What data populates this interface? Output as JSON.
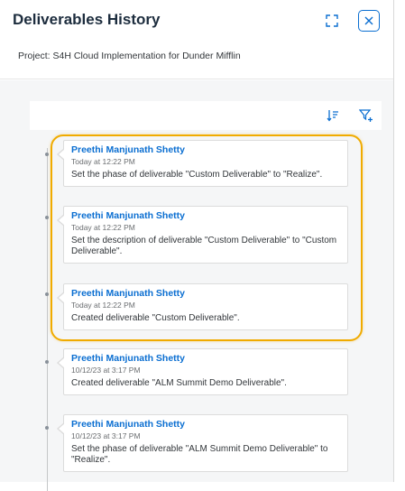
{
  "header": {
    "title": "Deliverables History",
    "subtitle": "Project: S4H Cloud Implementation for Dunder Mifflin"
  },
  "entries": [
    {
      "author": "Preethi Manjunath Shetty",
      "time": "Today at 12:22 PM",
      "message": "Set the phase of deliverable \"Custom Deliverable\" to \"Realize\"."
    },
    {
      "author": "Preethi Manjunath Shetty",
      "time": "Today at 12:22 PM",
      "message": "Set the description of deliverable \"Custom Deliverable\" to \"Custom Deliverable\"."
    },
    {
      "author": "Preethi Manjunath Shetty",
      "time": "Today at 12:22 PM",
      "message": "Created deliverable \"Custom Deliverable\"."
    },
    {
      "author": "Preethi Manjunath Shetty",
      "time": "10/12/23 at 3:17 PM",
      "message": "Created deliverable \"ALM Summit Demo Deliverable\"."
    },
    {
      "author": "Preethi Manjunath Shetty",
      "time": "10/12/23 at 3:17 PM",
      "message": "Set the phase of deliverable \"ALM Summit Demo Deliverable\" to \"Realize\"."
    }
  ],
  "icons": {
    "expand": "expand-icon",
    "close": "close-icon",
    "sort": "sort-icon",
    "filter": "filter-icon"
  },
  "colors": {
    "accent": "#0a6ed1",
    "highlight": "#f0ab00",
    "background": "#f5f6f7"
  }
}
